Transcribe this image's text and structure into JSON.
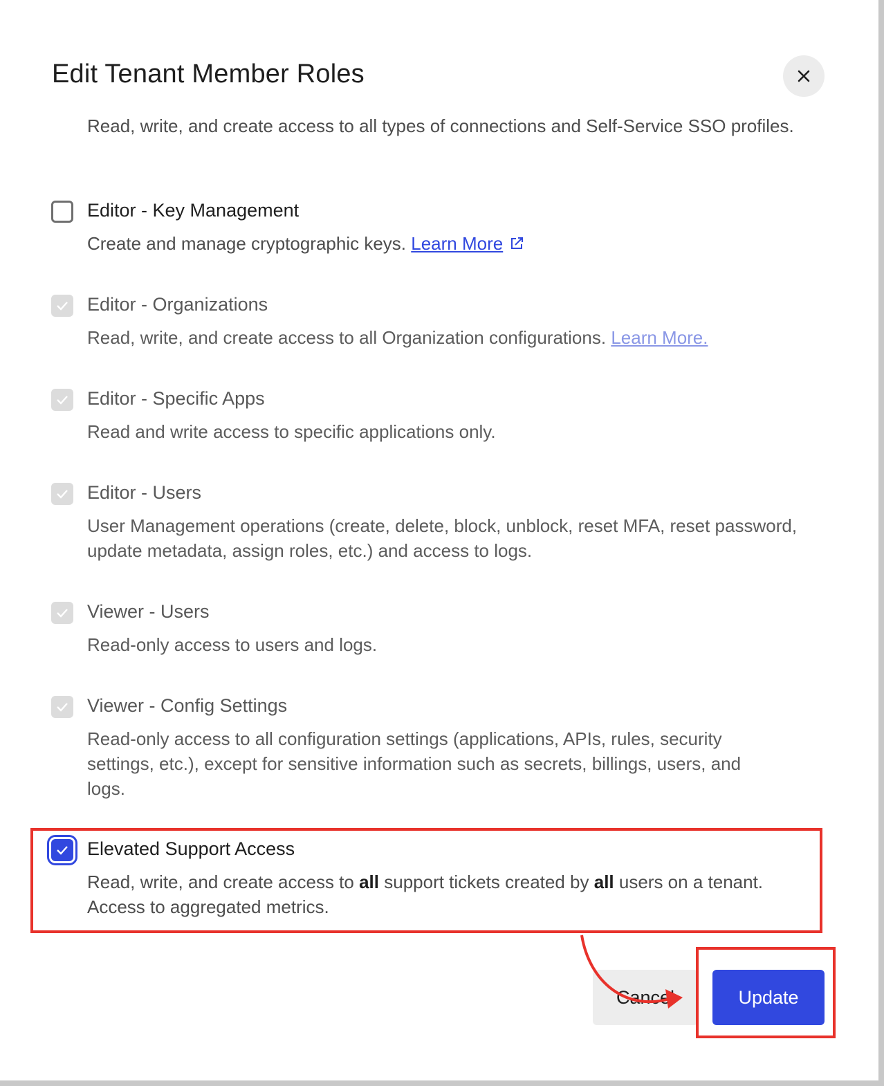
{
  "dialog": {
    "title": "Edit Tenant Member Roles",
    "close_icon": "close-icon"
  },
  "cutoff_description": "Read, write, and create access to all types of connections and Self-Service SSO profiles.",
  "roles": [
    {
      "name": "Editor - Key Management",
      "description": "Create and manage cryptographic keys.",
      "link": "Learn More",
      "link_icon": "external-link-icon",
      "state": "unchecked"
    },
    {
      "name": "Editor - Organizations",
      "description": "Read, write, and create access to all Organization configurations.",
      "link": "Learn More.",
      "state": "checked-disabled"
    },
    {
      "name": "Editor - Specific Apps",
      "description": "Read and write access to specific applications only.",
      "state": "checked-disabled"
    },
    {
      "name": "Editor - Users",
      "description": "User Management operations (create, delete, block, unblock, reset MFA, reset password, update metadata, assign roles, etc.) and access to logs.",
      "state": "checked-disabled"
    },
    {
      "name": "Viewer - Users",
      "description": "Read-only access to users and logs.",
      "state": "checked-disabled"
    },
    {
      "name": "Viewer - Config Settings",
      "description": "Read-only access to all configuration settings (applications, APIs, rules, security settings, etc.), except for sensitive information such as secrets, billings, users, and logs.",
      "state": "checked-disabled"
    },
    {
      "name": "Elevated Support Access",
      "description_parts": [
        "Read, write, and create access to ",
        "all",
        " support tickets created by ",
        "all",
        " users on a tenant. Access to aggregated metrics."
      ],
      "state": "checked"
    }
  ],
  "footer": {
    "cancel_label": "Cancel",
    "update_label": "Update"
  },
  "colors": {
    "primary": "#3148df",
    "annotation": "#e8322b",
    "disabled_checkbox": "#dcdcdc"
  }
}
